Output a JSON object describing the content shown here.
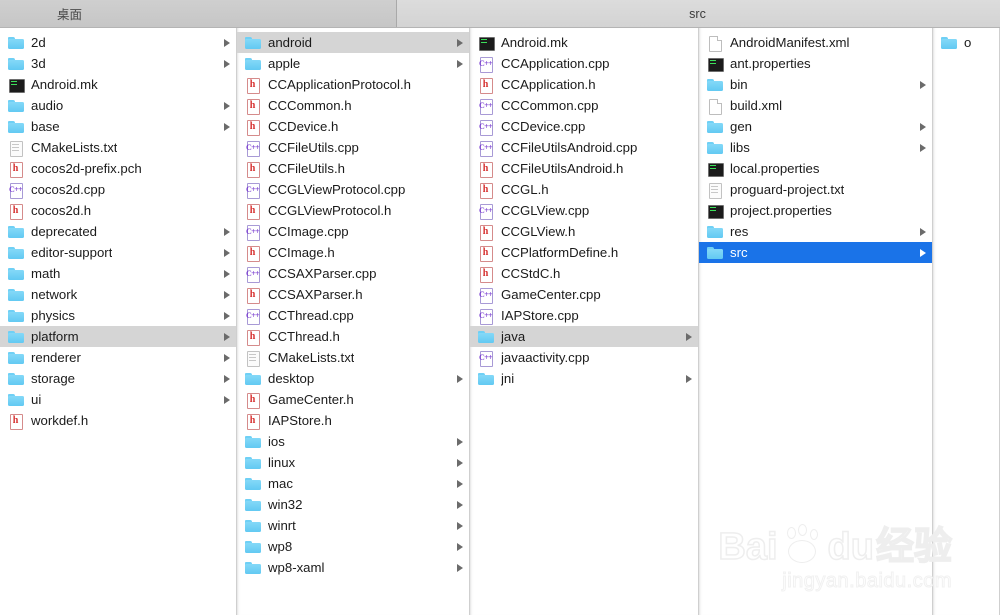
{
  "window": {
    "left_pane_title": "桌面",
    "right_pane_title": "src"
  },
  "watermark": {
    "brand_bai": "Bai",
    "brand_du": "du",
    "brand_cn": "经验",
    "url": "jingyan.baidu.com"
  },
  "colors": {
    "selection_active": "#1a73e8",
    "selection_inactive": "#d5d5d5",
    "folder_icon": "#62c9f2",
    "header_h_icon": "#d6302f",
    "cpp_icon": "#7b3fd1",
    "terminal_icon": "#1b1b1b"
  },
  "columns": [
    {
      "name": "column-1",
      "items": [
        {
          "label": "2d",
          "icon": "folder-icon",
          "expandable": true,
          "selected": "none"
        },
        {
          "label": "3d",
          "icon": "folder-icon",
          "expandable": true,
          "selected": "none"
        },
        {
          "label": "Android.mk",
          "icon": "terminal-icon",
          "expandable": false,
          "selected": "none"
        },
        {
          "label": "audio",
          "icon": "folder-icon",
          "expandable": true,
          "selected": "none"
        },
        {
          "label": "base",
          "icon": "folder-icon",
          "expandable": true,
          "selected": "none"
        },
        {
          "label": "CMakeLists.txt",
          "icon": "text-document-icon",
          "expandable": false,
          "selected": "none"
        },
        {
          "label": "cocos2d-prefix.pch",
          "icon": "header-file-icon",
          "expandable": false,
          "selected": "none"
        },
        {
          "label": "cocos2d.cpp",
          "icon": "cpp-file-icon",
          "expandable": false,
          "selected": "none"
        },
        {
          "label": "cocos2d.h",
          "icon": "header-file-icon",
          "expandable": false,
          "selected": "none"
        },
        {
          "label": "deprecated",
          "icon": "folder-icon",
          "expandable": true,
          "selected": "none"
        },
        {
          "label": "editor-support",
          "icon": "folder-icon",
          "expandable": true,
          "selected": "none"
        },
        {
          "label": "math",
          "icon": "folder-icon",
          "expandable": true,
          "selected": "none"
        },
        {
          "label": "network",
          "icon": "folder-icon",
          "expandable": true,
          "selected": "none"
        },
        {
          "label": "physics",
          "icon": "folder-icon",
          "expandable": true,
          "selected": "none"
        },
        {
          "label": "platform",
          "icon": "folder-icon",
          "expandable": true,
          "selected": "gray"
        },
        {
          "label": "renderer",
          "icon": "folder-icon",
          "expandable": true,
          "selected": "none"
        },
        {
          "label": "storage",
          "icon": "folder-icon",
          "expandable": true,
          "selected": "none"
        },
        {
          "label": "ui",
          "icon": "folder-icon",
          "expandable": true,
          "selected": "none"
        },
        {
          "label": "workdef.h",
          "icon": "header-file-icon",
          "expandable": false,
          "selected": "none"
        }
      ]
    },
    {
      "name": "column-2",
      "items": [
        {
          "label": "android",
          "icon": "folder-icon",
          "expandable": true,
          "selected": "gray"
        },
        {
          "label": "apple",
          "icon": "folder-icon",
          "expandable": true,
          "selected": "none"
        },
        {
          "label": "CCApplicationProtocol.h",
          "icon": "header-file-icon",
          "expandable": false,
          "selected": "none"
        },
        {
          "label": "CCCommon.h",
          "icon": "header-file-icon",
          "expandable": false,
          "selected": "none"
        },
        {
          "label": "CCDevice.h",
          "icon": "header-file-icon",
          "expandable": false,
          "selected": "none"
        },
        {
          "label": "CCFileUtils.cpp",
          "icon": "cpp-file-icon",
          "expandable": false,
          "selected": "none"
        },
        {
          "label": "CCFileUtils.h",
          "icon": "header-file-icon",
          "expandable": false,
          "selected": "none"
        },
        {
          "label": "CCGLViewProtocol.cpp",
          "icon": "cpp-file-icon",
          "expandable": false,
          "selected": "none"
        },
        {
          "label": "CCGLViewProtocol.h",
          "icon": "header-file-icon",
          "expandable": false,
          "selected": "none"
        },
        {
          "label": "CCImage.cpp",
          "icon": "cpp-file-icon",
          "expandable": false,
          "selected": "none"
        },
        {
          "label": "CCImage.h",
          "icon": "header-file-icon",
          "expandable": false,
          "selected": "none"
        },
        {
          "label": "CCSAXParser.cpp",
          "icon": "cpp-file-icon",
          "expandable": false,
          "selected": "none"
        },
        {
          "label": "CCSAXParser.h",
          "icon": "header-file-icon",
          "expandable": false,
          "selected": "none"
        },
        {
          "label": "CCThread.cpp",
          "icon": "cpp-file-icon",
          "expandable": false,
          "selected": "none"
        },
        {
          "label": "CCThread.h",
          "icon": "header-file-icon",
          "expandable": false,
          "selected": "none"
        },
        {
          "label": "CMakeLists.txt",
          "icon": "text-document-icon",
          "expandable": false,
          "selected": "none"
        },
        {
          "label": "desktop",
          "icon": "folder-icon",
          "expandable": true,
          "selected": "none"
        },
        {
          "label": "GameCenter.h",
          "icon": "header-file-icon",
          "expandable": false,
          "selected": "none"
        },
        {
          "label": "IAPStore.h",
          "icon": "header-file-icon",
          "expandable": false,
          "selected": "none"
        },
        {
          "label": "ios",
          "icon": "folder-icon",
          "expandable": true,
          "selected": "none"
        },
        {
          "label": "linux",
          "icon": "folder-icon",
          "expandable": true,
          "selected": "none"
        },
        {
          "label": "mac",
          "icon": "folder-icon",
          "expandable": true,
          "selected": "none"
        },
        {
          "label": "win32",
          "icon": "folder-icon",
          "expandable": true,
          "selected": "none"
        },
        {
          "label": "winrt",
          "icon": "folder-icon",
          "expandable": true,
          "selected": "none"
        },
        {
          "label": "wp8",
          "icon": "folder-icon",
          "expandable": true,
          "selected": "none"
        },
        {
          "label": "wp8-xaml",
          "icon": "folder-icon",
          "expandable": true,
          "selected": "none"
        }
      ]
    },
    {
      "name": "column-3",
      "items": [
        {
          "label": "Android.mk",
          "icon": "terminal-icon",
          "expandable": false,
          "selected": "none"
        },
        {
          "label": "CCApplication.cpp",
          "icon": "cpp-file-icon",
          "expandable": false,
          "selected": "none"
        },
        {
          "label": "CCApplication.h",
          "icon": "header-file-icon",
          "expandable": false,
          "selected": "none"
        },
        {
          "label": "CCCommon.cpp",
          "icon": "cpp-file-icon",
          "expandable": false,
          "selected": "none"
        },
        {
          "label": "CCDevice.cpp",
          "icon": "cpp-file-icon",
          "expandable": false,
          "selected": "none"
        },
        {
          "label": "CCFileUtilsAndroid.cpp",
          "icon": "cpp-file-icon",
          "expandable": false,
          "selected": "none"
        },
        {
          "label": "CCFileUtilsAndroid.h",
          "icon": "header-file-icon",
          "expandable": false,
          "selected": "none"
        },
        {
          "label": "CCGL.h",
          "icon": "header-file-icon",
          "expandable": false,
          "selected": "none"
        },
        {
          "label": "CCGLView.cpp",
          "icon": "cpp-file-icon",
          "expandable": false,
          "selected": "none"
        },
        {
          "label": "CCGLView.h",
          "icon": "header-file-icon",
          "expandable": false,
          "selected": "none"
        },
        {
          "label": "CCPlatformDefine.h",
          "icon": "header-file-icon",
          "expandable": false,
          "selected": "none"
        },
        {
          "label": "CCStdC.h",
          "icon": "header-file-icon",
          "expandable": false,
          "selected": "none"
        },
        {
          "label": "GameCenter.cpp",
          "icon": "cpp-file-icon",
          "expandable": false,
          "selected": "none"
        },
        {
          "label": "IAPStore.cpp",
          "icon": "cpp-file-icon",
          "expandable": false,
          "selected": "none"
        },
        {
          "label": "java",
          "icon": "folder-icon",
          "expandable": true,
          "selected": "gray"
        },
        {
          "label": "javaactivity.cpp",
          "icon": "cpp-file-icon",
          "expandable": false,
          "selected": "none"
        },
        {
          "label": "jni",
          "icon": "folder-icon",
          "expandable": true,
          "selected": "none"
        }
      ]
    },
    {
      "name": "column-4",
      "items": [
        {
          "label": "AndroidManifest.xml",
          "icon": "document-icon",
          "expandable": false,
          "selected": "none"
        },
        {
          "label": "ant.properties",
          "icon": "terminal-icon",
          "expandable": false,
          "selected": "none"
        },
        {
          "label": "bin",
          "icon": "folder-icon",
          "expandable": true,
          "selected": "none"
        },
        {
          "label": "build.xml",
          "icon": "document-icon",
          "expandable": false,
          "selected": "none"
        },
        {
          "label": "gen",
          "icon": "folder-icon",
          "expandable": true,
          "selected": "none"
        },
        {
          "label": "libs",
          "icon": "folder-icon",
          "expandable": true,
          "selected": "none"
        },
        {
          "label": "local.properties",
          "icon": "terminal-icon",
          "expandable": false,
          "selected": "none"
        },
        {
          "label": "proguard-project.txt",
          "icon": "text-document-icon",
          "expandable": false,
          "selected": "none"
        },
        {
          "label": "project.properties",
          "icon": "terminal-icon",
          "expandable": false,
          "selected": "none"
        },
        {
          "label": "res",
          "icon": "folder-icon",
          "expandable": true,
          "selected": "none"
        },
        {
          "label": "src",
          "icon": "folder-icon",
          "expandable": true,
          "selected": "blue"
        }
      ]
    },
    {
      "name": "column-5",
      "items": [
        {
          "label": "o",
          "icon": "folder-icon",
          "expandable": false,
          "selected": "none"
        }
      ]
    }
  ]
}
